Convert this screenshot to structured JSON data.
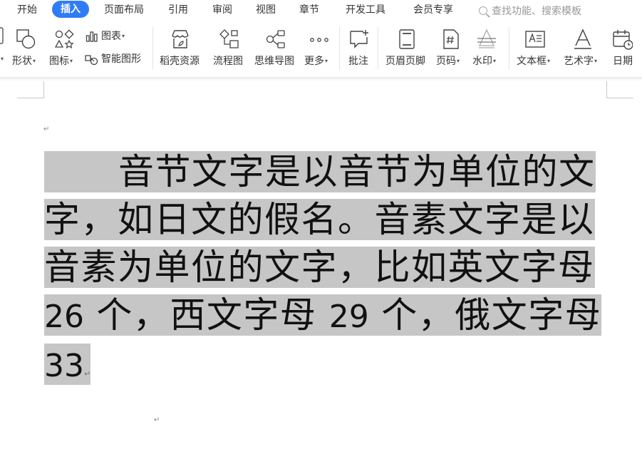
{
  "menu": {
    "tabs": [
      {
        "label": "开始",
        "active": false
      },
      {
        "label": "插入",
        "active": true
      },
      {
        "label": "页面布局",
        "active": false
      },
      {
        "label": "引用",
        "active": false
      },
      {
        "label": "审阅",
        "active": false
      },
      {
        "label": "视图",
        "active": false
      },
      {
        "label": "章节",
        "active": false
      },
      {
        "label": "开发工具",
        "active": false
      },
      {
        "label": "会员专享",
        "active": false
      }
    ],
    "search_placeholder": "查找功能、搜索模板",
    "accent_color": "#2f7cf6"
  },
  "ribbon": {
    "shape": "形状",
    "icon": "图标",
    "chart": "图表",
    "smart_graphic": "智能图形",
    "docer_resources": "稻壳资源",
    "flowchart": "流程图",
    "mind_map": "思维导图",
    "more": "更多",
    "comment": "批注",
    "header_footer": "页眉页脚",
    "page_number": "页码",
    "watermark": "水印",
    "text_box": "文本框",
    "word_art": "艺术字",
    "date": "日期"
  },
  "document": {
    "text_line1": "音节文字是以音节为单位的文字，如日文的假名。音素文字是以音素为单位的文字，比如英文字母",
    "num_26": "26",
    "text_line2": " 个，西文字母 ",
    "num_29": "29",
    "text_line3": " 个，俄文字母",
    "num_33": "33",
    "selection_color": "#c6c6c6"
  }
}
